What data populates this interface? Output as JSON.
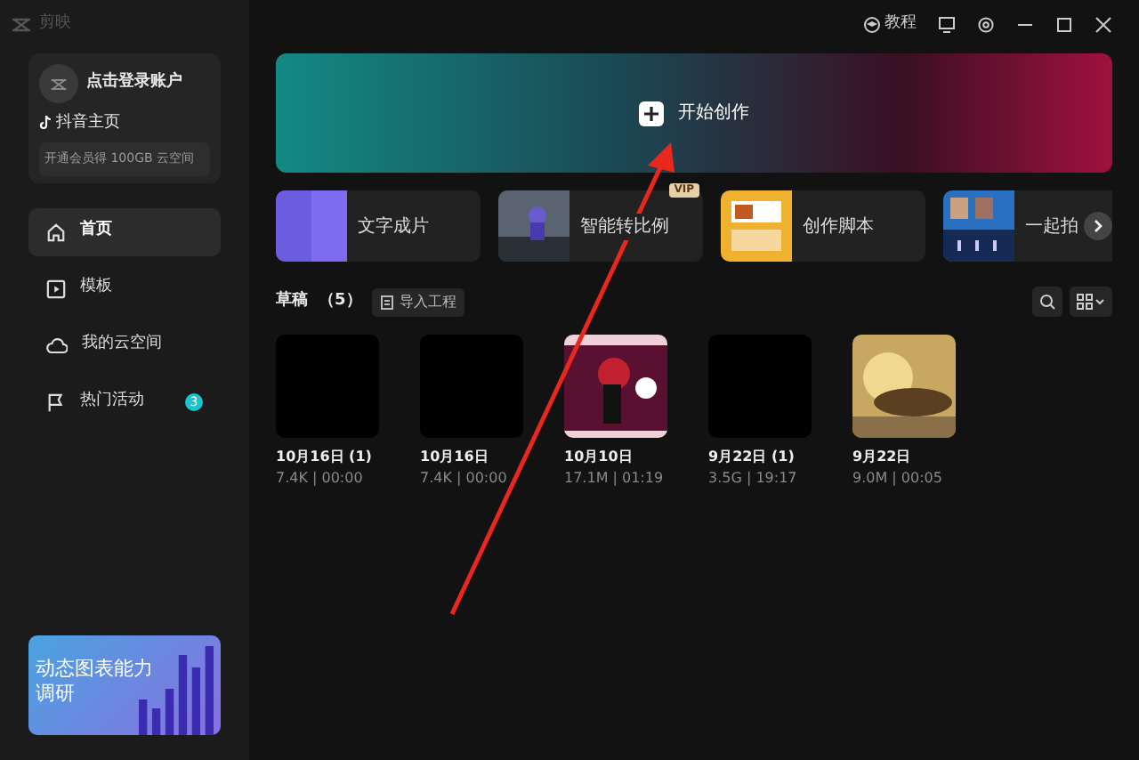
{
  "app": {
    "logo": "剪映"
  },
  "title_bar": {
    "tutorial": "教程"
  },
  "account": {
    "login": "点击登录账户",
    "douyin": "抖音主页",
    "promo": "开通会员得 100GB 云空间"
  },
  "sidebar": {
    "items": [
      {
        "label": "首页",
        "selected": true
      },
      {
        "label": "模板",
        "selected": false
      },
      {
        "label": "我的云空间",
        "selected": false
      },
      {
        "label": "热门活动",
        "selected": false,
        "badge": "3"
      }
    ]
  },
  "ad_banner": {
    "text": "动态图表能力调研"
  },
  "create": {
    "label": "开始创作"
  },
  "features": [
    {
      "label": "文字成片"
    },
    {
      "label": "智能转比例",
      "tag": "VIP"
    },
    {
      "label": "创作脚本"
    },
    {
      "label": "一起拍"
    }
  ],
  "drafts": {
    "title": "草稿",
    "count": "（5）",
    "import": "导入工程",
    "items": [
      {
        "name": "10月16日 (1)",
        "meta": "7.4K | 00:00"
      },
      {
        "name": "10月16日",
        "meta": "7.4K | 00:00"
      },
      {
        "name": "10月10日",
        "meta": "17.1M | 01:19",
        "kind": "picture"
      },
      {
        "name": "9月22日 (1)",
        "meta": "3.5G | 19:17"
      },
      {
        "name": "9月22日",
        "meta": "9.0M | 00:05",
        "kind": "picture"
      }
    ]
  }
}
